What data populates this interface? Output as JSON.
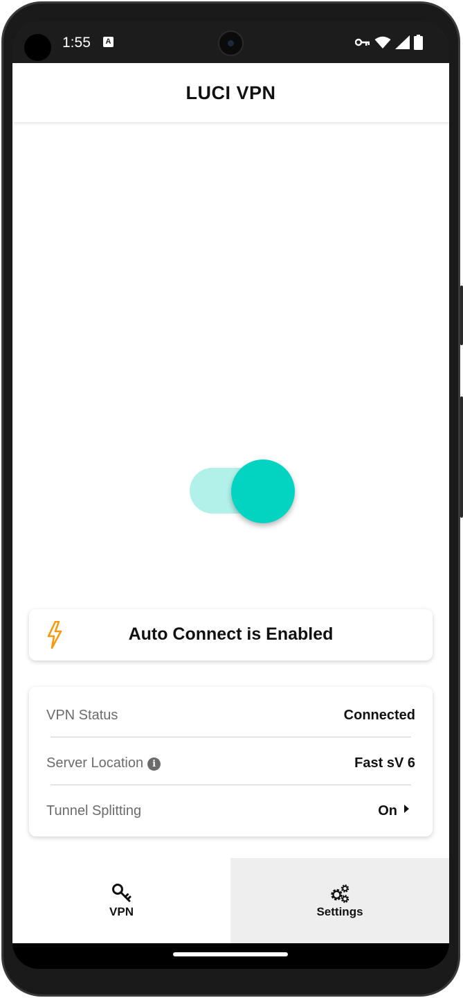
{
  "status_bar": {
    "time": "1:55",
    "notification_glyph": "A",
    "icons": [
      "vpn-key-icon",
      "wifi-icon",
      "signal-icon",
      "battery-icon"
    ]
  },
  "app": {
    "title": "LUCI VPN"
  },
  "vpn_toggle": {
    "state": "on",
    "track_color": "#b2f1ea",
    "thumb_color": "#03d4c2"
  },
  "auto_connect": {
    "icon": "lightning-bolt-icon",
    "icon_color": "#f59a0c",
    "text": "Auto Connect is Enabled"
  },
  "info": {
    "rows": [
      {
        "label": "VPN Status",
        "value": "Connected"
      },
      {
        "label": "Server Location",
        "value": "Fast sV 6",
        "has_info_icon": true
      },
      {
        "label": "Tunnel Splitting",
        "value": "On",
        "has_chevron": true
      }
    ],
    "info_icon_glyph": "i"
  },
  "bottom_nav": {
    "items": [
      {
        "label": "VPN",
        "icon": "key-icon",
        "selected": false
      },
      {
        "label": "Settings",
        "icon": "gears-icon",
        "selected": true
      }
    ]
  },
  "colors": {
    "accent": "#03d4c2",
    "accent_light": "#b2f1ea",
    "bolt": "#f59a0c",
    "selected_nav_bg": "#eeeeee"
  }
}
